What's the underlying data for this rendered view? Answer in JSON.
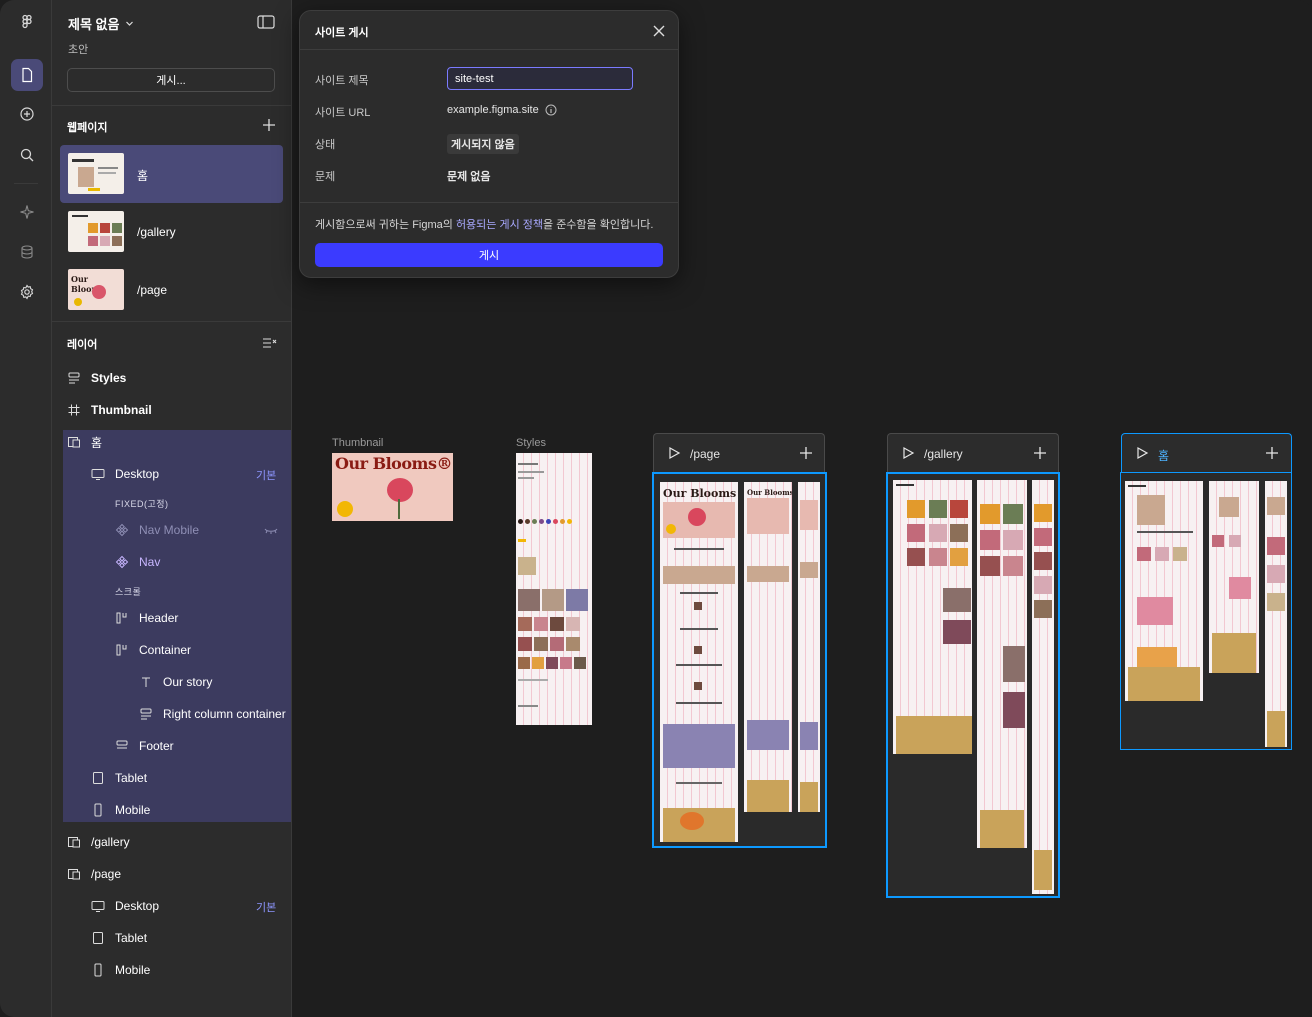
{
  "app": {
    "file_title": "제목 없음",
    "file_status": "초안",
    "publish_button": "게시..."
  },
  "rail": {
    "icons": [
      "figma-logo-icon",
      "file-icon",
      "add-circle-icon",
      "search-icon",
      "ai-sparkle-icon",
      "database-icon",
      "settings-icon"
    ]
  },
  "webpages": {
    "heading": "웹페이지",
    "pages": [
      {
        "label": "홈",
        "selected": true
      },
      {
        "label": "/gallery",
        "selected": false
      },
      {
        "label": "/page",
        "selected": false
      }
    ]
  },
  "layers": {
    "heading": "레이어",
    "rows": [
      {
        "label": "Styles",
        "icon": "style-icon",
        "bold": true
      },
      {
        "label": "Thumbnail",
        "icon": "frame-hash-icon",
        "bold": true
      },
      {
        "label": "홈",
        "icon": "webpage-icon"
      },
      {
        "label": "Desktop",
        "icon": "desktop-icon",
        "tag": "기본"
      },
      {
        "label": "FIXED(고정)",
        "icon": "",
        "caption": true
      },
      {
        "label": "Nav Mobile",
        "icon": "component-icon",
        "hidden": true
      },
      {
        "label": "Nav",
        "icon": "component-icon"
      },
      {
        "label": "스크롤",
        "icon": "",
        "caption": true
      },
      {
        "label": "Header",
        "icon": "auto-layout-icon"
      },
      {
        "label": "Container",
        "icon": "auto-layout-icon"
      },
      {
        "label": "Our story",
        "icon": "text-icon"
      },
      {
        "label": "Right column container",
        "icon": "stack-icon"
      },
      {
        "label": "Footer",
        "icon": "stack-icon"
      },
      {
        "label": "Tablet",
        "icon": "tablet-icon"
      },
      {
        "label": "Mobile",
        "icon": "mobile-icon"
      },
      {
        "label": "/gallery",
        "icon": "webpage-icon"
      },
      {
        "label": "/page",
        "icon": "webpage-icon"
      },
      {
        "label": "Desktop",
        "icon": "desktop-icon",
        "tag": "기본"
      },
      {
        "label": "Tablet",
        "icon": "tablet-icon"
      },
      {
        "label": "Mobile",
        "icon": "mobile-icon"
      }
    ]
  },
  "dialog": {
    "title": "사이트 게시",
    "site_title_label": "사이트 제목",
    "site_title_value": "site-test",
    "url_label": "사이트 URL",
    "url_value": "example.figma.site",
    "status_label": "상태",
    "status_value": "게시되지 않음",
    "issues_label": "문제",
    "issues_value": "문제 없음",
    "terms_prefix": "게시함으로써 귀하는 Figma의 ",
    "terms_link": "허용되는 게시 정책",
    "terms_suffix": "을 준수함을 확인합니다.",
    "publish_button": "게시"
  },
  "canvas": {
    "thumbnail_label": "Thumbnail",
    "thumbnail_text": "Our Blooms®",
    "styles_label": "Styles",
    "frames": [
      {
        "label": "/page"
      },
      {
        "label": "/gallery"
      },
      {
        "label": "홈"
      }
    ],
    "colors": {
      "selection": "#0d99ff",
      "accent": "#3b3bff",
      "layer_highlight": "#3c3b5f"
    }
  }
}
